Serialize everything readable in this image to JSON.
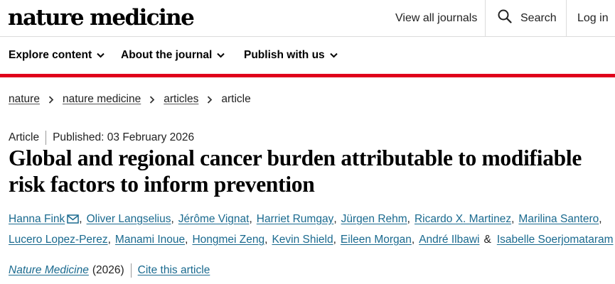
{
  "header": {
    "logo": "nature medicine",
    "view_all_journals": "View all journals",
    "search": "Search",
    "login": "Log in"
  },
  "nav": {
    "items": [
      {
        "label": "Explore content"
      },
      {
        "label": "About the journal"
      },
      {
        "label": "Publish with us"
      }
    ]
  },
  "breadcrumb": {
    "items": [
      "nature",
      "nature medicine",
      "articles"
    ],
    "current": "article"
  },
  "article": {
    "type": "Article",
    "published": "Published: 03 February 2026",
    "title": "Global and regional cancer burden attributable to modifiable risk factors to inform prevention",
    "authors_row1": [
      "Hanna Fink",
      "Oliver Langselius",
      "Jérôme Vignat",
      "Harriet Rumgay",
      "Jürgen Rehm",
      "Ricardo X. Martinez",
      "Marilina Santero"
    ],
    "authors_row2": [
      "Lucero Lopez-Perez",
      "Manami Inoue",
      "Hongmei Zeng",
      "Kevin Shield",
      "Eileen Morgan",
      "André Ilbawi",
      "Isabelle Soerjomataram"
    ],
    "separator": ",",
    "ampersand": "&",
    "journal": "Nature Medicine",
    "year": "(2026)",
    "cite": "Cite this article"
  },
  "colors": {
    "accent_rule": "#e0001b",
    "link": "#1a6a8f"
  },
  "icons": [
    "search-icon",
    "chevron-down-icon",
    "chevron-right-icon",
    "mail-icon"
  ]
}
